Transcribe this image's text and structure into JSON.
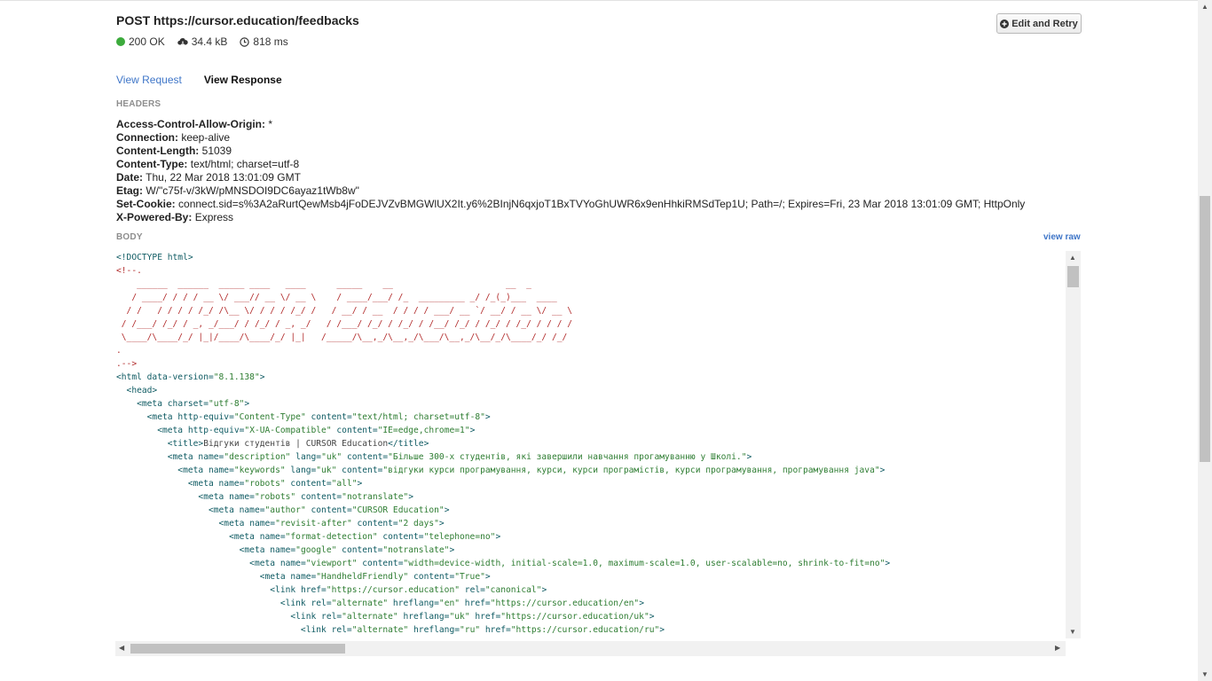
{
  "request": {
    "title": "POST https://cursor.education/feedbacks",
    "status_text": "200 OK",
    "status_color": "#3cab3c",
    "size": "34.4 kB",
    "time": "818 ms",
    "icons": [
      "cloud-download-icon",
      "clock-icon"
    ]
  },
  "actions": {
    "edit_retry_label": "Edit and Retry",
    "edit_retry_icon": "plus-circle-icon"
  },
  "tabs": {
    "request_label": "View Request",
    "response_label": "View Response"
  },
  "headers_section": {
    "label": "HEADERS",
    "items": [
      {
        "key": "Access-Control-Allow-Origin:",
        "value": " *"
      },
      {
        "key": "Connection:",
        "value": " keep-alive"
      },
      {
        "key": "Content-Length:",
        "value": " 51039"
      },
      {
        "key": "Content-Type:",
        "value": " text/html; charset=utf-8"
      },
      {
        "key": "Date:",
        "value": " Thu, 22 Mar 2018 13:01:09 GMT"
      },
      {
        "key": "Etag:",
        "value": " W/\"c75f-v/3kW/pMNSDOI9DC6ayaz1tWb8w\""
      },
      {
        "key": "Set-Cookie:",
        "value": " connect.sid=s%3A2aRurtQewMsb4jFoDEJVZvBMGWlUX2It.y6%2BInjN6qxjoT1BxTVYoGhUWR6x9enHhkiRMSdTep1U; Path=/; Expires=Fri, 23 Mar 2018 13:01:09 GMT; HttpOnly"
      },
      {
        "key": "X-Powered-By:",
        "value": " Express"
      }
    ]
  },
  "body_section": {
    "label": "BODY",
    "view_raw_label": "view raw",
    "lines": [
      [
        {
          "t": "<!DOCTYPE html>",
          "c": "tg"
        }
      ],
      [
        {
          "t": "<!--.",
          "c": "cm"
        }
      ],
      [
        {
          "t": "    ______  ______  _____ ____   ____      _____    __                      __  _",
          "c": "cm"
        }
      ],
      [
        {
          "t": "   / ____/ / / / __ \\/ ___// __ \\/ __ \\    / ____/___/ /_  _________ _/ /_(_)___  ____",
          "c": "cm"
        }
      ],
      [
        {
          "t": "  / /   / / / / /_/ /\\__ \\/ / / / /_/ /   / __/ / __  / / / / ___/ __ `/ __/ / __ \\/ __ \\",
          "c": "cm"
        }
      ],
      [
        {
          "t": " / /___/ /_/ / _, _/___/ / /_/ / _, _/   / /___/ /_/ / /_/ / /__/ /_/ / /_/ / /_/ / / / /",
          "c": "cm"
        }
      ],
      [
        {
          "t": " \\____/\\____/_/ |_|/____/\\____/_/ |_|   /_____/\\__,_/\\__,_/\\___/\\__,_/\\__/_/\\____/_/ /_/",
          "c": "cm"
        }
      ],
      [
        {
          "t": ".",
          "c": "cm"
        }
      ],
      [
        {
          "t": ".-->",
          "c": "cm"
        }
      ],
      [
        {
          "t": "<html ",
          "c": "tg"
        },
        {
          "t": "data-version=",
          "c": "an"
        },
        {
          "t": "\"8.1.138\"",
          "c": "av"
        },
        {
          "t": ">",
          "c": "tg"
        }
      ],
      [
        {
          "t": "  <head>",
          "c": "tg"
        }
      ],
      [
        {
          "t": "    <meta ",
          "c": "tg"
        },
        {
          "t": "charset=",
          "c": "an"
        },
        {
          "t": "\"utf-8\"",
          "c": "av"
        },
        {
          "t": ">",
          "c": "tg"
        }
      ],
      [
        {
          "t": "      <meta ",
          "c": "tg"
        },
        {
          "t": "http-equiv=",
          "c": "an"
        },
        {
          "t": "\"Content-Type\"",
          "c": "av"
        },
        {
          "t": " content=",
          "c": "an"
        },
        {
          "t": "\"text/html; charset=utf-8\"",
          "c": "av"
        },
        {
          "t": ">",
          "c": "tg"
        }
      ],
      [
        {
          "t": "        <meta ",
          "c": "tg"
        },
        {
          "t": "http-equiv=",
          "c": "an"
        },
        {
          "t": "\"X-UA-Compatible\"",
          "c": "av"
        },
        {
          "t": " content=",
          "c": "an"
        },
        {
          "t": "\"IE=edge,chrome=1\"",
          "c": "av"
        },
        {
          "t": ">",
          "c": "tg"
        }
      ],
      [
        {
          "t": "          <title>",
          "c": "tg"
        },
        {
          "t": "Відгуки студентів | CURSOR Education",
          "c": ""
        },
        {
          "t": "</title>",
          "c": "tg"
        }
      ],
      [
        {
          "t": "          <meta ",
          "c": "tg"
        },
        {
          "t": "name=",
          "c": "an"
        },
        {
          "t": "\"description\"",
          "c": "av"
        },
        {
          "t": " lang=",
          "c": "an"
        },
        {
          "t": "\"uk\"",
          "c": "av"
        },
        {
          "t": " content=",
          "c": "an"
        },
        {
          "t": "\"Більше 300-х студентів, які завершили навчання прогамуванню у Школі.\"",
          "c": "av"
        },
        {
          "t": ">",
          "c": "tg"
        }
      ],
      [
        {
          "t": "            <meta ",
          "c": "tg"
        },
        {
          "t": "name=",
          "c": "an"
        },
        {
          "t": "\"keywords\"",
          "c": "av"
        },
        {
          "t": " lang=",
          "c": "an"
        },
        {
          "t": "\"uk\"",
          "c": "av"
        },
        {
          "t": " content=",
          "c": "an"
        },
        {
          "t": "\"відгуки курси програмування, курси, курси програмістів, курси програмування, програмування java\"",
          "c": "av"
        },
        {
          "t": ">",
          "c": "tg"
        }
      ],
      [
        {
          "t": "              <meta ",
          "c": "tg"
        },
        {
          "t": "name=",
          "c": "an"
        },
        {
          "t": "\"robots\"",
          "c": "av"
        },
        {
          "t": " content=",
          "c": "an"
        },
        {
          "t": "\"all\"",
          "c": "av"
        },
        {
          "t": ">",
          "c": "tg"
        }
      ],
      [
        {
          "t": "                <meta ",
          "c": "tg"
        },
        {
          "t": "name=",
          "c": "an"
        },
        {
          "t": "\"robots\"",
          "c": "av"
        },
        {
          "t": " content=",
          "c": "an"
        },
        {
          "t": "\"notranslate\"",
          "c": "av"
        },
        {
          "t": ">",
          "c": "tg"
        }
      ],
      [
        {
          "t": "                  <meta ",
          "c": "tg"
        },
        {
          "t": "name=",
          "c": "an"
        },
        {
          "t": "\"author\"",
          "c": "av"
        },
        {
          "t": " content=",
          "c": "an"
        },
        {
          "t": "\"CURSOR Education\"",
          "c": "av"
        },
        {
          "t": ">",
          "c": "tg"
        }
      ],
      [
        {
          "t": "                    <meta ",
          "c": "tg"
        },
        {
          "t": "name=",
          "c": "an"
        },
        {
          "t": "\"revisit-after\"",
          "c": "av"
        },
        {
          "t": " content=",
          "c": "an"
        },
        {
          "t": "\"2 days\"",
          "c": "av"
        },
        {
          "t": ">",
          "c": "tg"
        }
      ],
      [
        {
          "t": "                      <meta ",
          "c": "tg"
        },
        {
          "t": "name=",
          "c": "an"
        },
        {
          "t": "\"format-detection\"",
          "c": "av"
        },
        {
          "t": " content=",
          "c": "an"
        },
        {
          "t": "\"telephone=no\"",
          "c": "av"
        },
        {
          "t": ">",
          "c": "tg"
        }
      ],
      [
        {
          "t": "                        <meta ",
          "c": "tg"
        },
        {
          "t": "name=",
          "c": "an"
        },
        {
          "t": "\"google\"",
          "c": "av"
        },
        {
          "t": " content=",
          "c": "an"
        },
        {
          "t": "\"notranslate\"",
          "c": "av"
        },
        {
          "t": ">",
          "c": "tg"
        }
      ],
      [
        {
          "t": "                          <meta ",
          "c": "tg"
        },
        {
          "t": "name=",
          "c": "an"
        },
        {
          "t": "\"viewport\"",
          "c": "av"
        },
        {
          "t": " content=",
          "c": "an"
        },
        {
          "t": "\"width=device-width, initial-scale=1.0, maximum-scale=1.0, user-scalable=no, shrink-to-fit=no\"",
          "c": "av"
        },
        {
          "t": ">",
          "c": "tg"
        }
      ],
      [
        {
          "t": "                            <meta ",
          "c": "tg"
        },
        {
          "t": "name=",
          "c": "an"
        },
        {
          "t": "\"HandheldFriendly\"",
          "c": "av"
        },
        {
          "t": " content=",
          "c": "an"
        },
        {
          "t": "\"True\"",
          "c": "av"
        },
        {
          "t": ">",
          "c": "tg"
        }
      ],
      [
        {
          "t": "                              <link ",
          "c": "tg"
        },
        {
          "t": "href=",
          "c": "an"
        },
        {
          "t": "\"https://cursor.education\"",
          "c": "av"
        },
        {
          "t": " rel=",
          "c": "an"
        },
        {
          "t": "\"canonical\"",
          "c": "av"
        },
        {
          "t": ">",
          "c": "tg"
        }
      ],
      [
        {
          "t": "                                <link ",
          "c": "tg"
        },
        {
          "t": "rel=",
          "c": "an"
        },
        {
          "t": "\"alternate\"",
          "c": "av"
        },
        {
          "t": " hreflang=",
          "c": "an"
        },
        {
          "t": "\"en\"",
          "c": "av"
        },
        {
          "t": " href=",
          "c": "an"
        },
        {
          "t": "\"https://cursor.education/en\"",
          "c": "av"
        },
        {
          "t": ">",
          "c": "tg"
        }
      ],
      [
        {
          "t": "                                  <link ",
          "c": "tg"
        },
        {
          "t": "rel=",
          "c": "an"
        },
        {
          "t": "\"alternate\"",
          "c": "av"
        },
        {
          "t": " hreflang=",
          "c": "an"
        },
        {
          "t": "\"uk\"",
          "c": "av"
        },
        {
          "t": " href=",
          "c": "an"
        },
        {
          "t": "\"https://cursor.education/uk\"",
          "c": "av"
        },
        {
          "t": ">",
          "c": "tg"
        }
      ],
      [
        {
          "t": "                                    <link ",
          "c": "tg"
        },
        {
          "t": "rel=",
          "c": "an"
        },
        {
          "t": "\"alternate\"",
          "c": "av"
        },
        {
          "t": " hreflang=",
          "c": "an"
        },
        {
          "t": "\"ru\"",
          "c": "av"
        },
        {
          "t": " href=",
          "c": "an"
        },
        {
          "t": "\"https://cursor.education/ru\"",
          "c": "av"
        },
        {
          "t": ">",
          "c": "tg"
        }
      ]
    ]
  }
}
